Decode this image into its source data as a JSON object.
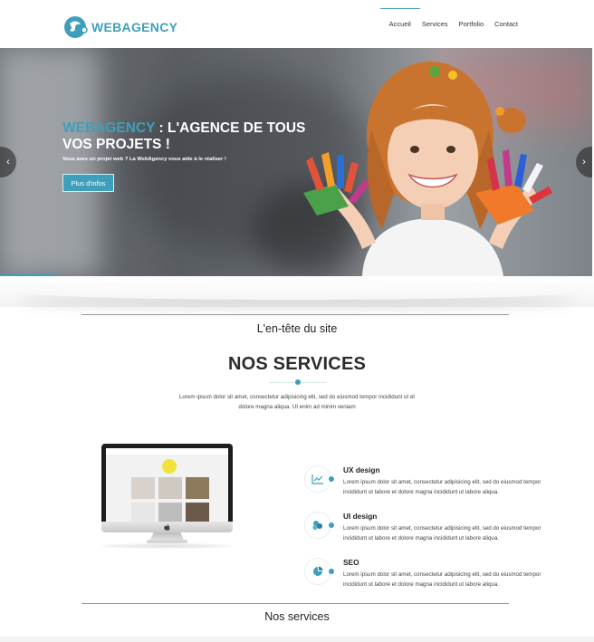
{
  "brand": {
    "name": "WEBAGENCY",
    "color": "#3e9fbc"
  },
  "nav": {
    "items": [
      {
        "label": "Accueil"
      },
      {
        "label": "Services"
      },
      {
        "label": "Portfolio"
      },
      {
        "label": "Contact"
      }
    ],
    "active": "Accueil"
  },
  "hero": {
    "title_brand": "WEBAGENCY",
    "title_rest": " : L'AGENCE DE TOUS VOS PROJETS !",
    "subtitle": "Vous avez un projet web ? La WebAgency vous aide à le réaliser !",
    "button_label": "Plus d'infos",
    "prev_icon": "chevron-left-icon",
    "next_icon": "chevron-right-icon"
  },
  "section_header": {
    "label": "L'en-tête du site"
  },
  "services": {
    "title": "NOS SERVICES",
    "intro": "Lorem ipsum dolor sit amet, consectetur adipisicing elit, sed do eiusmod tempor incididunt ut et dolore magna aliqua. Ut enim ad minim veniam",
    "items": [
      {
        "name": "UX design",
        "icon": "chart-icon",
        "text": "Lorem ipsum dolor sit amet, consectetur adipisicing elit, sed do eiusmod tempor incididunt ut labore et dolore magna incididunt ut labore aliqua."
      },
      {
        "name": "UI design",
        "icon": "coins-icon",
        "text": "Lorem ipsum dolor sit amet, consectetur adipisicing elit, sed do eiusmod tempor incididunt ut labore et dolore magna incididunt ut labore aliqua."
      },
      {
        "name": "SEO",
        "icon": "pie-chart-icon",
        "text": "Lorem ipsum dolor sit amet, consectetur adipisicing elit, sed do eiusmod tempor incididunt ut labore et dolore magna incididunt ut labore aliqua."
      }
    ]
  },
  "section_footer": {
    "label": "Nos services"
  }
}
